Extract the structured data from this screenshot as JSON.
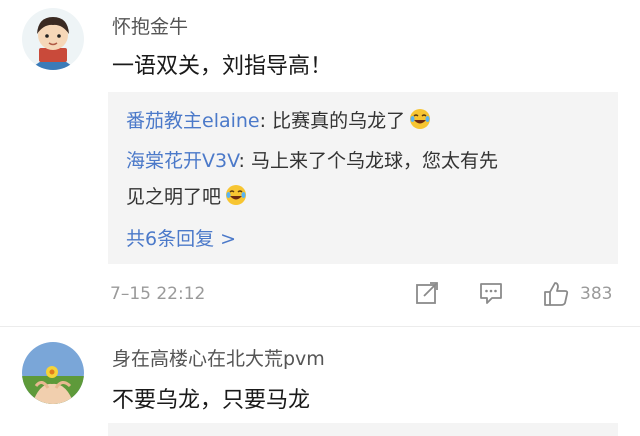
{
  "comments": [
    {
      "username": "怀抱金牛",
      "content": "一语双关，刘指导高！",
      "replies": [
        {
          "user": "番茄教主elaine",
          "text": ": 比赛真的乌龙了",
          "emoji": "laughing-crying-emoji"
        },
        {
          "user": "海棠花开V3V",
          "text": ": 马上来了个乌龙球，您太有先",
          "text2": "见之明了吧",
          "emoji": "laughing-crying-emoji"
        }
      ],
      "more_replies": "共6条回复 >",
      "timestamp": "7–15 22:12",
      "like_count": "383"
    },
    {
      "username": "身在高楼心在北大荒pvm",
      "content": "不要乌龙，只要马龙"
    }
  ],
  "icons": {
    "share": "edit-share-icon",
    "reply": "comment-icon",
    "like": "thumbs-up-icon"
  },
  "colors": {
    "link_blue": "#4b79c9",
    "meta_gray": "#9a9a9a",
    "reply_bg": "#f4f4f4"
  }
}
